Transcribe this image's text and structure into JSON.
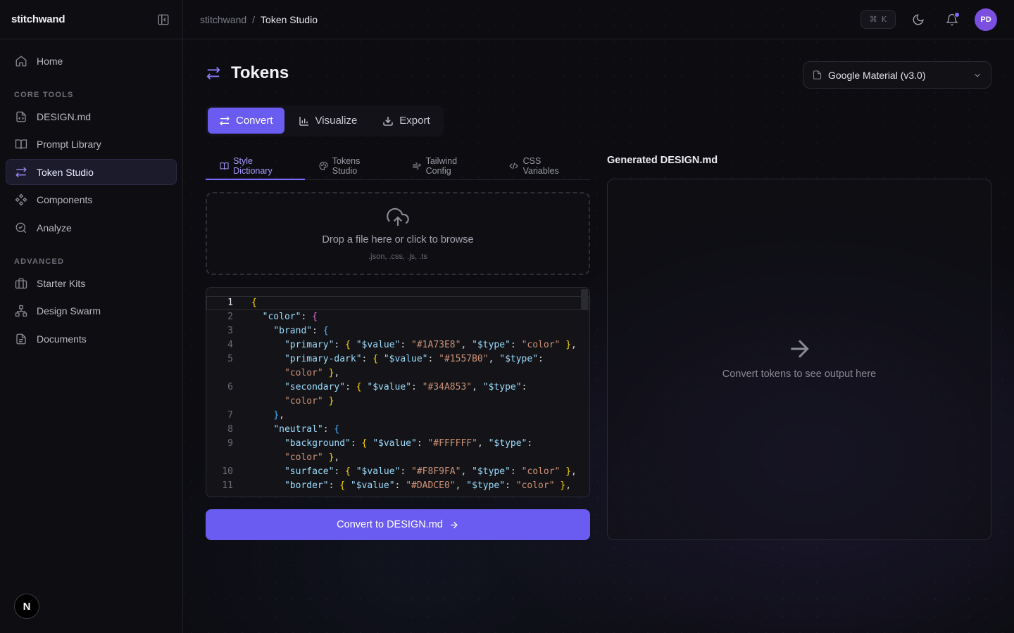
{
  "app": {
    "brand": "stitchwand"
  },
  "sidebar": {
    "items": [
      {
        "label": "Home",
        "icon": "home-icon"
      },
      {
        "label": "DESIGN.md",
        "icon": "file-code-icon"
      },
      {
        "label": "Prompt Library",
        "icon": "book-icon"
      },
      {
        "label": "Token Studio",
        "icon": "arrows-swap-icon"
      },
      {
        "label": "Components",
        "icon": "components-icon"
      },
      {
        "label": "Analyze",
        "icon": "search-scan-icon"
      },
      {
        "label": "Starter Kits",
        "icon": "briefcase-icon"
      },
      {
        "label": "Design Swarm",
        "icon": "network-icon"
      },
      {
        "label": "Documents",
        "icon": "document-icon"
      }
    ],
    "sections": {
      "core": "CORE TOOLS",
      "advanced": "ADVANCED"
    },
    "footer_logo": "N"
  },
  "topbar": {
    "breadcrumb": {
      "root": "stitchwand",
      "sep": "/",
      "current": "Token Studio"
    },
    "shortcut": {
      "cmd": "⌘",
      "key": "K"
    },
    "avatar_initials": "PD"
  },
  "page": {
    "title": "Tokens",
    "preset": "Google Material (v3.0)",
    "modes": [
      "Convert",
      "Visualize",
      "Export"
    ],
    "subtabs": [
      "Style Dictionary",
      "Tokens Studio",
      "Tailwind Config",
      "CSS Variables"
    ],
    "dropzone": {
      "title": "Drop a file here or click to browse",
      "formats": ".json, .css, .js, .ts"
    },
    "convert_button": "Convert to DESIGN.md",
    "output": {
      "title": "Generated DESIGN.md",
      "empty": "Convert tokens to see output here"
    }
  },
  "editor": {
    "lines": [
      {
        "n": "1",
        "text": "{"
      },
      {
        "n": "2",
        "text": "  \"color\": {"
      },
      {
        "n": "3",
        "text": "    \"brand\": {"
      },
      {
        "n": "4",
        "text": "      \"primary\": { \"$value\": \"#1A73E8\", \"$type\": \"color\" },"
      },
      {
        "n": "5",
        "text": "      \"primary-dark\": { \"$value\": \"#1557B0\", \"$type\":"
      },
      {
        "n": "",
        "text": "      \"color\" },"
      },
      {
        "n": "6",
        "text": "      \"secondary\": { \"$value\": \"#34A853\", \"$type\":"
      },
      {
        "n": "",
        "text": "      \"color\" }"
      },
      {
        "n": "7",
        "text": "    },"
      },
      {
        "n": "8",
        "text": "    \"neutral\": {"
      },
      {
        "n": "9",
        "text": "      \"background\": { \"$value\": \"#FFFFFF\", \"$type\":"
      },
      {
        "n": "",
        "text": "      \"color\" },"
      },
      {
        "n": "10",
        "text": "      \"surface\": { \"$value\": \"#F8F9FA\", \"$type\": \"color\" },"
      },
      {
        "n": "11",
        "text": "      \"border\": { \"$value\": \"#DADCE0\", \"$type\": \"color\" },"
      }
    ]
  },
  "colors": {
    "accent": "#6a5cf0",
    "accent_text": "#a79bff",
    "bg": "#0c0c11"
  }
}
